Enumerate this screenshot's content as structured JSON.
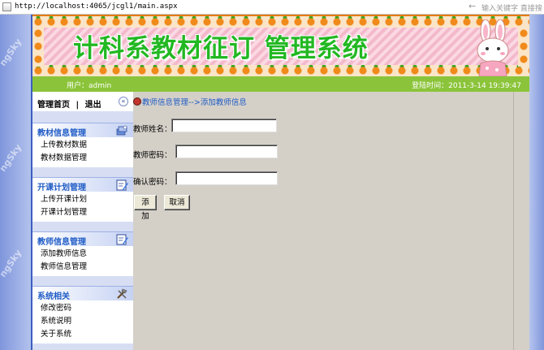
{
  "browser": {
    "url": "http://localhost:4065/jcgl1/main.aspx",
    "search_placeholder": "输入关键字 直接搜"
  },
  "banner": {
    "title": "计科系教材征订 管理系统"
  },
  "infobar": {
    "user_label": "用户：admin",
    "login_time": "登陆时间：2011-3-14 19:39:47"
  },
  "watermark_text": "ngSky",
  "menu": {
    "home": "管理首页",
    "separator": "|",
    "logout": "退出",
    "groups": [
      {
        "title": "教材信息管理",
        "icon": "books-icon",
        "items": [
          "上传教材数据",
          "教材数据管理"
        ]
      },
      {
        "title": "开课计划管理",
        "icon": "edit-note-icon",
        "items": [
          "上传开课计划",
          "开课计划管理"
        ]
      },
      {
        "title": "教师信息管理",
        "icon": "edit-note-icon",
        "items": [
          "添加教师信息",
          "教师信息管理"
        ]
      },
      {
        "title": "系统相关",
        "icon": "tools-icon",
        "items": [
          "修改密码",
          "系统说明",
          "关于系统"
        ]
      }
    ]
  },
  "main": {
    "breadcrumb": "教师信息管理-->添加教师信息",
    "fields": [
      {
        "label": "教师姓名：",
        "value": ""
      },
      {
        "label": "教师密码：",
        "value": ""
      },
      {
        "label": "确认密码：",
        "value": ""
      }
    ],
    "add_button": "添加",
    "cancel_button": "取消"
  }
}
